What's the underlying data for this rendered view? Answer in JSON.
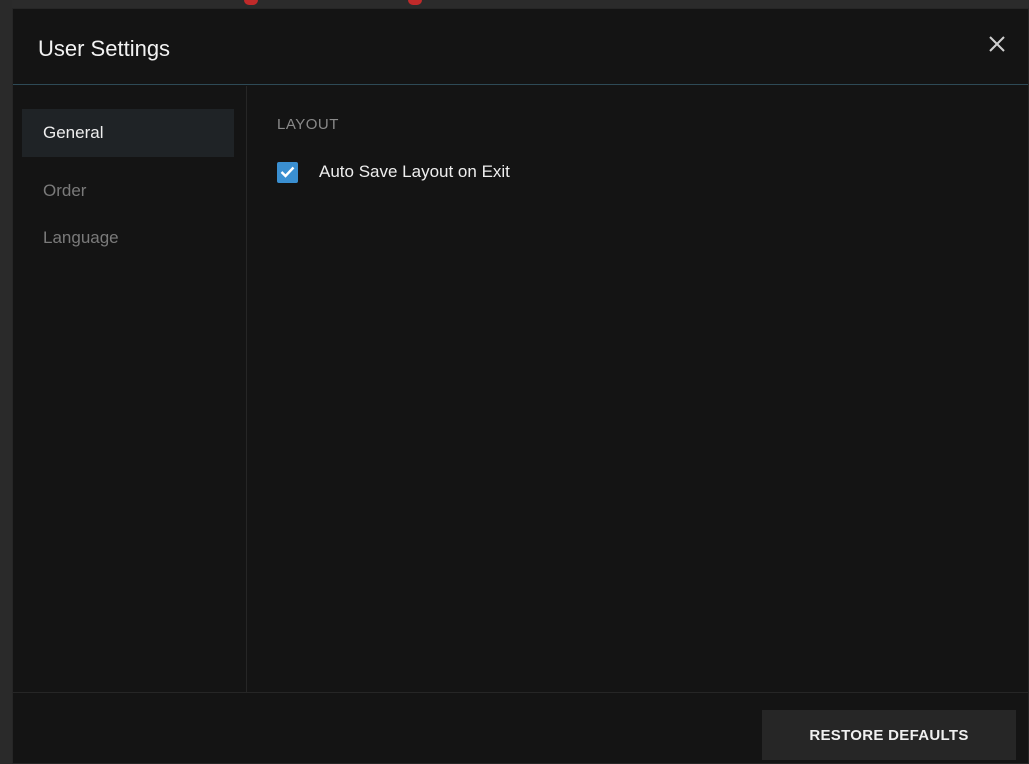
{
  "dialog": {
    "title": "User Settings",
    "close_icon": "close-icon"
  },
  "sidebar": {
    "items": [
      {
        "label": "General",
        "active": true
      },
      {
        "label": "Order",
        "active": false
      },
      {
        "label": "Language",
        "active": false
      }
    ]
  },
  "content": {
    "section_title": "LAYOUT",
    "options": [
      {
        "label": "Auto Save Layout on Exit",
        "checked": true
      }
    ]
  },
  "footer": {
    "restore_label": "RESTORE DEFAULTS"
  },
  "colors": {
    "accent": "#3a8fd1",
    "header_divider": "#2e4a56",
    "dialog_bg": "#141414"
  }
}
